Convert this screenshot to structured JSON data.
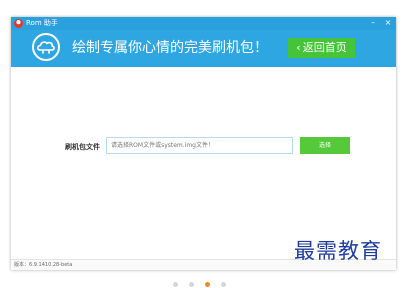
{
  "window": {
    "app_title": "Rom 助手",
    "minimize_label": "–",
    "close_label": "×"
  },
  "banner": {
    "title": "绘制专属你心情的完美刷机包！",
    "home_chevron": "‹",
    "home_label": "返回首页"
  },
  "form": {
    "label": "刷机包文件",
    "placeholder": "请选择ROM文件或system.img文件！",
    "select_label": "选择"
  },
  "statusbar": {
    "version": "版本：6.9.1410.28-beta"
  },
  "watermark": "最需教育",
  "pager": {
    "count": 4,
    "active_index": 2
  },
  "colors": {
    "titlebar": "#2aa0dc",
    "banner": "#2ea6e2",
    "button_green": "#45c43a",
    "pager_active": "#f08a24"
  }
}
